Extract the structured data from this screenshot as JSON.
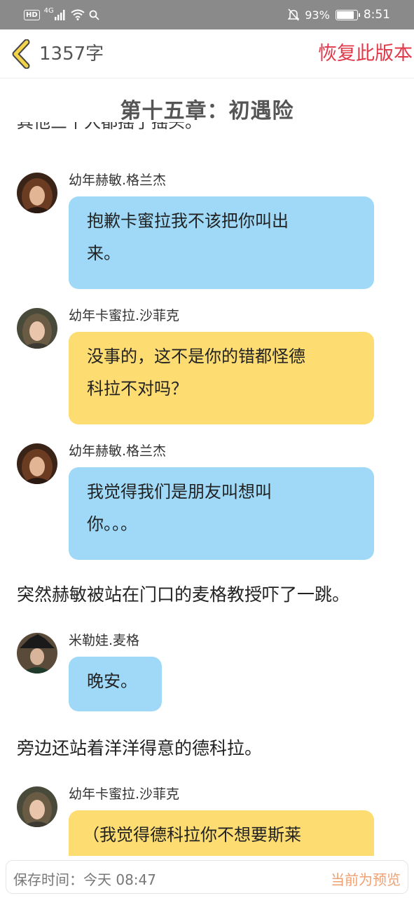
{
  "status_bar": {
    "network": "4G",
    "hd": "HD",
    "battery": "93%",
    "battery_level": 0.93,
    "time": "8:51",
    "icons": [
      "hd-icon",
      "signal-icon",
      "wifi-icon",
      "search-icon",
      "mute-icon",
      "battery-icon"
    ]
  },
  "header": {
    "word_count": "1357字",
    "restore_label": "恢复此版本"
  },
  "content": {
    "chapter_title": "第十五章：初遇险",
    "cut_text": "其他三个人都摇了摇头。",
    "items": [
      {
        "type": "message",
        "sender": "幼年赫敏.格兰杰",
        "style": "blue",
        "lines": [
          "抱歉卡蜜拉我不该把你叫出",
          "来。"
        ]
      },
      {
        "type": "message",
        "sender": "幼年卡蜜拉.沙菲克",
        "style": "yellow",
        "lines": [
          "没事的，这不是你的错都怪德",
          "科拉不对吗？"
        ]
      },
      {
        "type": "message",
        "sender": "幼年赫敏.格兰杰",
        "style": "blue",
        "lines": [
          "我觉得我们是朋友叫想叫",
          "你。。。"
        ]
      },
      {
        "type": "narration",
        "text": "突然赫敏被站在门口的麦格教授吓了一跳。"
      },
      {
        "type": "message",
        "sender": "米勒娃.麦格",
        "style": "blue",
        "lines": [
          "晚安。"
        ]
      },
      {
        "type": "narration",
        "text": "旁边还站着洋洋得意的德科拉。"
      },
      {
        "type": "message",
        "sender": "幼年卡蜜拉.沙菲克",
        "style": "yellow",
        "lines": [
          "（我觉得德科拉你不想要斯莱"
        ]
      }
    ]
  },
  "footer": {
    "save_time": "保存时间：今天 08:47",
    "preview_label": "当前为预览"
  },
  "colors": {
    "accent_red": "#e0394a",
    "bubble_blue": "#9fd9f7",
    "bubble_yellow": "#fddc72",
    "preview_orange": "#f0a070",
    "back_chevron": "#f3d34a"
  }
}
